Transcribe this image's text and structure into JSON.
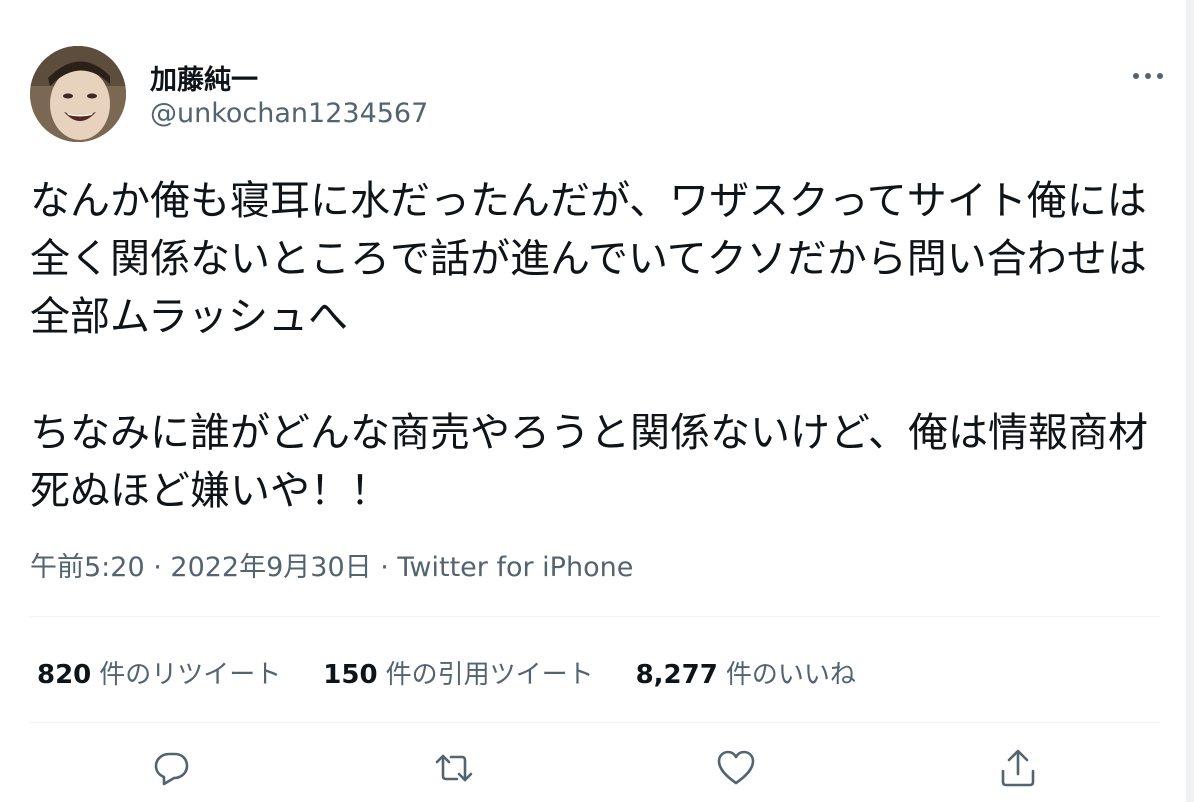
{
  "user": {
    "display_name": "加藤純一",
    "handle": "@unkochan1234567"
  },
  "tweet": {
    "text": "なんか俺も寝耳に水だったんだが、ワザスクってサイト俺には全く関係ないところで話が進んでいてクソだから問い合わせは全部ムラッシュへ\n\nちなみに誰がどんな商売やろうと関係ないけど、俺は情報商材死ぬほど嫌いや！！",
    "time": "午前5:20",
    "date": "2022年9月30日",
    "separator": " · ",
    "source": "Twitter for iPhone"
  },
  "stats": {
    "retweets": {
      "count": "820",
      "label": "件のリツイート"
    },
    "quotes": {
      "count": "150",
      "label": "件の引用ツイート"
    },
    "likes": {
      "count": "8,277",
      "label": "件のいいね"
    }
  },
  "icons": {
    "more": "more-dots-icon",
    "reply": "reply-bubble-icon",
    "retweet": "retweet-arrows-icon",
    "like": "heart-icon",
    "share": "share-upload-icon"
  },
  "colors": {
    "text_primary": "#0f1419",
    "text_secondary": "#536471",
    "divider": "#eff3f4"
  }
}
